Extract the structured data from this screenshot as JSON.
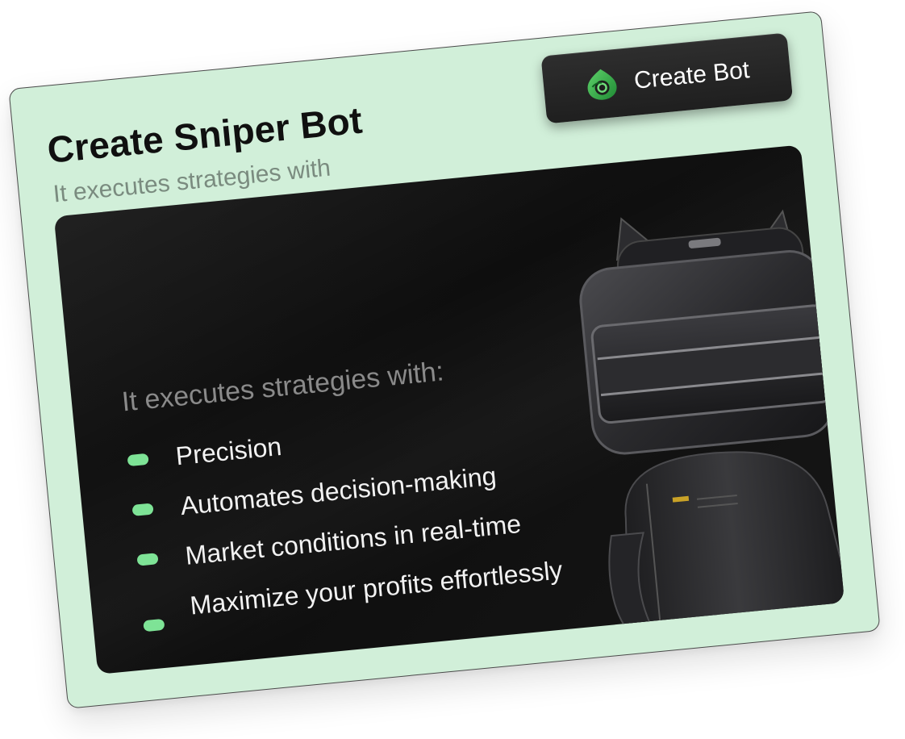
{
  "card": {
    "title": "Create Sniper Bot",
    "subtitle": "It executes strategies with"
  },
  "create_button": {
    "label": "Create Bot",
    "icon": "sniper-logo-icon",
    "accent": "#3db54a"
  },
  "panel": {
    "heading": "It executes strategies with:",
    "features": [
      {
        "label": "Precision"
      },
      {
        "label": "Automates decision-making"
      },
      {
        "label": "Market conditions in real-time"
      },
      {
        "label": "Maximize your profits effortlessly"
      }
    ],
    "bullet_color": "#7ee396",
    "image": "robot-illustration"
  },
  "colors": {
    "card_bg": "#d1efd9",
    "panel_bg": "#121212",
    "button_bg": "#262626"
  }
}
